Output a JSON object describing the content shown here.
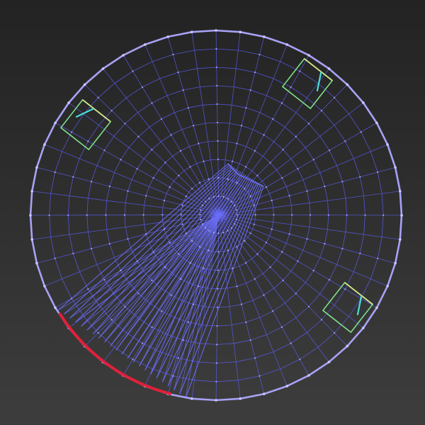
{
  "viewport": {
    "background_top": "#232323",
    "background_bottom": "#3d3d3d"
  },
  "colors": {
    "wire": "#5a5cf0",
    "wire_light": "#6b6ef5",
    "rim": "#a7a2f6",
    "selection": "#e0203a",
    "gizmo_green": "#7ee08a",
    "gizmo_cyan": "#46e0d6",
    "gizmo_yellow": "#d6e68a",
    "vertex": "#c9c6ff"
  },
  "mesh": {
    "name": "dome-wireframe",
    "radial_segments": 48,
    "rings": 9,
    "fan_lines": 22,
    "selected_edge": "rim-lower-left"
  },
  "gizmos": [
    {
      "id": "light-gizmo-top-left"
    },
    {
      "id": "light-gizmo-top-right"
    },
    {
      "id": "light-gizmo-bottom-right"
    }
  ]
}
